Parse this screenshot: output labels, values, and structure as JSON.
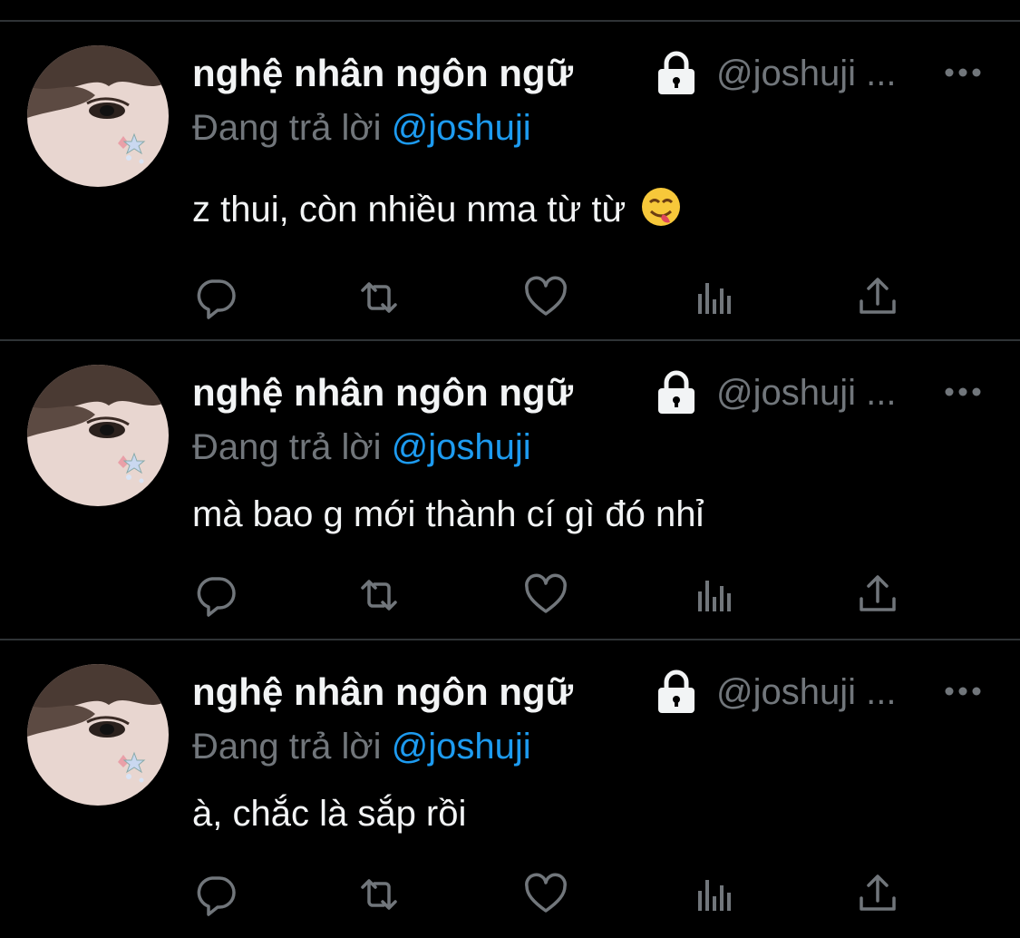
{
  "colors": {
    "background": "#000000",
    "name": "#f2f4f5",
    "muted": "#71767b",
    "mention": "#1d9bf0",
    "divider": "#2f3336"
  },
  "tweets": [
    {
      "display_name": "nghệ nhân ngôn ngữ",
      "handle": "@joshuji ...",
      "reply_prefix": "Đang trả lời",
      "reply_to": "@joshuji",
      "text": "z thui, còn nhiều nma từ từ",
      "emoji": "face-savoring-food-emoji"
    },
    {
      "display_name": "nghệ nhân ngôn ngữ",
      "handle": "@joshuji ...",
      "reply_prefix": "Đang trả lời",
      "reply_to": "@joshuji",
      "text": "mà bao g mới thành cí gì đó nhỉ"
    },
    {
      "display_name": "nghệ nhân ngôn ngữ",
      "handle": "@joshuji ...",
      "reply_prefix": "Đang trả lời",
      "reply_to": "@joshuji",
      "text": "à, chắc là sắp rồi"
    }
  ],
  "icons": [
    "reply-icon",
    "retweet-icon",
    "like-icon",
    "analytics-icon",
    "share-icon",
    "lock-icon",
    "more-icon"
  ]
}
